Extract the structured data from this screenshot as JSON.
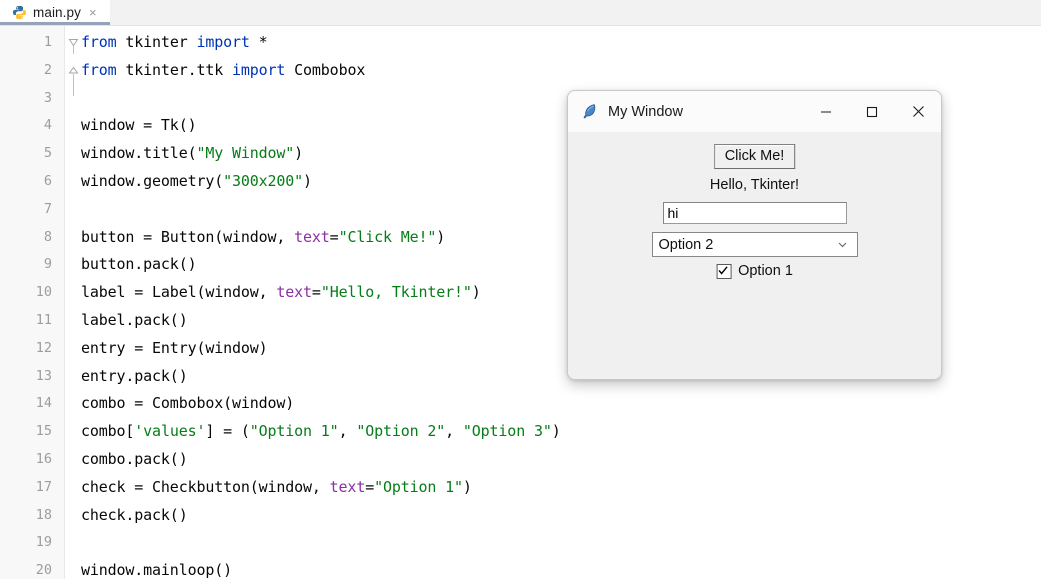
{
  "editor": {
    "tab": {
      "label": "main.py",
      "close_label": "×",
      "icon": "python-file-icon",
      "underline_color": "#93a3b8"
    },
    "line_numbers": [
      "1",
      "2",
      "3",
      "4",
      "5",
      "6",
      "7",
      "8",
      "9",
      "10",
      "11",
      "12",
      "13",
      "14",
      "15",
      "16",
      "17",
      "18",
      "19",
      "20"
    ],
    "code_lines": [
      {
        "n": 1,
        "tokens": [
          {
            "t": "from",
            "c": "kw"
          },
          {
            "t": " tkinter ",
            "c": "plain"
          },
          {
            "t": "import",
            "c": "kw"
          },
          {
            "t": " *",
            "c": "plain"
          }
        ]
      },
      {
        "n": 2,
        "tokens": [
          {
            "t": "from",
            "c": "kw"
          },
          {
            "t": " tkinter.ttk ",
            "c": "plain"
          },
          {
            "t": "import",
            "c": "kw"
          },
          {
            "t": " Combobox",
            "c": "plain"
          }
        ]
      },
      {
        "n": 3,
        "tokens": []
      },
      {
        "n": 4,
        "tokens": [
          {
            "t": "window = Tk()",
            "c": "plain"
          }
        ]
      },
      {
        "n": 5,
        "tokens": [
          {
            "t": "window.title(",
            "c": "plain"
          },
          {
            "t": "\"My Window\"",
            "c": "str"
          },
          {
            "t": ")",
            "c": "plain"
          }
        ]
      },
      {
        "n": 6,
        "tokens": [
          {
            "t": "window.geometry(",
            "c": "plain"
          },
          {
            "t": "\"300x200\"",
            "c": "str"
          },
          {
            "t": ")",
            "c": "plain"
          }
        ]
      },
      {
        "n": 7,
        "tokens": []
      },
      {
        "n": 8,
        "tokens": [
          {
            "t": "button = Button(window, ",
            "c": "plain"
          },
          {
            "t": "text",
            "c": "kwarg"
          },
          {
            "t": "=",
            "c": "plain"
          },
          {
            "t": "\"Click Me!\"",
            "c": "str"
          },
          {
            "t": ")",
            "c": "plain"
          }
        ]
      },
      {
        "n": 9,
        "tokens": [
          {
            "t": "button.pack()",
            "c": "plain"
          }
        ]
      },
      {
        "n": 10,
        "tokens": [
          {
            "t": "label = Label(window, ",
            "c": "plain"
          },
          {
            "t": "text",
            "c": "kwarg"
          },
          {
            "t": "=",
            "c": "plain"
          },
          {
            "t": "\"Hello, Tkinter!\"",
            "c": "str"
          },
          {
            "t": ")",
            "c": "plain"
          }
        ]
      },
      {
        "n": 11,
        "tokens": [
          {
            "t": "label.pack()",
            "c": "plain"
          }
        ]
      },
      {
        "n": 12,
        "tokens": [
          {
            "t": "entry = Entry(window)",
            "c": "plain"
          }
        ]
      },
      {
        "n": 13,
        "tokens": [
          {
            "t": "entry.pack()",
            "c": "plain"
          }
        ]
      },
      {
        "n": 14,
        "tokens": [
          {
            "t": "combo = Combobox(window)",
            "c": "plain"
          }
        ]
      },
      {
        "n": 15,
        "tokens": [
          {
            "t": "combo[",
            "c": "plain"
          },
          {
            "t": "'values'",
            "c": "str"
          },
          {
            "t": "] = (",
            "c": "plain"
          },
          {
            "t": "\"Option 1\"",
            "c": "str"
          },
          {
            "t": ", ",
            "c": "plain"
          },
          {
            "t": "\"Option 2\"",
            "c": "str"
          },
          {
            "t": ", ",
            "c": "plain"
          },
          {
            "t": "\"Option 3\"",
            "c": "str"
          },
          {
            "t": ")",
            "c": "plain"
          }
        ]
      },
      {
        "n": 16,
        "tokens": [
          {
            "t": "combo.pack()",
            "c": "plain"
          }
        ]
      },
      {
        "n": 17,
        "tokens": [
          {
            "t": "check = Checkbutton(window, ",
            "c": "plain"
          },
          {
            "t": "text",
            "c": "kwarg"
          },
          {
            "t": "=",
            "c": "plain"
          },
          {
            "t": "\"Option 1\"",
            "c": "str"
          },
          {
            "t": ")",
            "c": "plain"
          }
        ]
      },
      {
        "n": 18,
        "tokens": [
          {
            "t": "check.pack()",
            "c": "plain"
          }
        ]
      },
      {
        "n": 19,
        "tokens": []
      },
      {
        "n": 20,
        "tokens": [
          {
            "t": "window.mainloop()",
            "c": "plain"
          }
        ]
      }
    ],
    "colors": {
      "keyword": "#0033b3",
      "string": "#067d17",
      "kwarg": "#8c2fa6",
      "text": "#080808",
      "gutter_bg": "#f8f8f8",
      "gutter_text": "#9d9d9d"
    }
  },
  "tk_window": {
    "title": "My Window",
    "icon": "tk-feather-icon",
    "titlebar_buttons": {
      "minimize": "minimize-icon",
      "maximize": "maximize-icon",
      "close": "close-icon"
    },
    "widgets": {
      "button_label": "Click Me!",
      "label_text": "Hello, Tkinter!",
      "entry_value": "hi",
      "entry_placeholder": "",
      "combo_selected": "Option 2",
      "combo_options": [
        "Option 1",
        "Option 2",
        "Option 3"
      ],
      "checkbox_label": "Option 1",
      "checkbox_checked": true
    }
  }
}
